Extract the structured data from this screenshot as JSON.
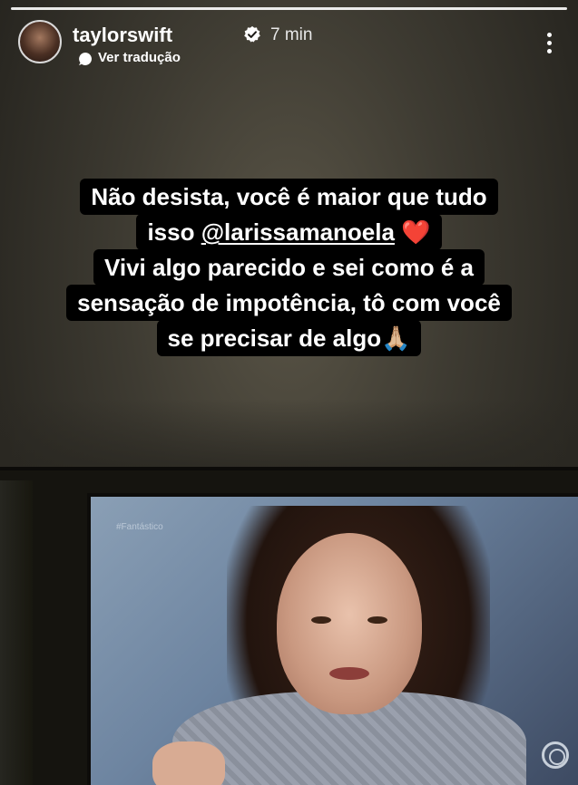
{
  "story": {
    "username": "taylorswift",
    "time": "7 min",
    "translate_label": "Ver tradução",
    "caption": {
      "line1": "Não desista, você é maior que tudo",
      "line2_prefix": "isso ",
      "mention": "@larissamanoela",
      "heart": "❤️",
      "line3": "Vivi algo parecido e sei como é a",
      "line4": "sensação de impotência, tô com você",
      "line5": "se precisar de algo🙏🏼"
    },
    "tv_tag": "#Fantástico"
  },
  "icons": {
    "verified": "verified-badge-icon",
    "translate": "translate-icon",
    "menu": "more-vertical-icon"
  },
  "colors": {
    "heart": "#e0242f",
    "caption_bg": "#000000",
    "verified_bg": "#ffffff"
  }
}
